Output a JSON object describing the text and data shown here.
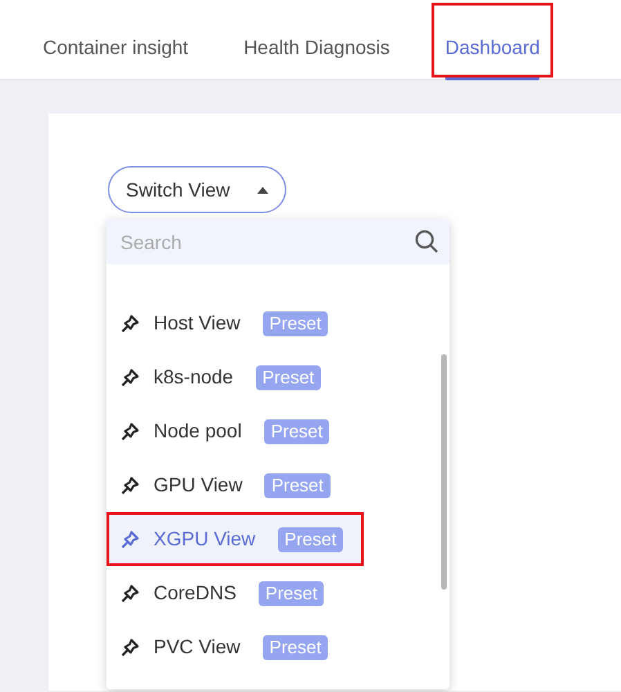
{
  "tabs": [
    {
      "label": "Container insight",
      "selected": false,
      "highlighted": false
    },
    {
      "label": "Health Diagnosis",
      "selected": false,
      "highlighted": false
    },
    {
      "label": "Dashboard",
      "selected": true,
      "highlighted": true
    }
  ],
  "switch_view": {
    "label": "Switch View",
    "expanded": true
  },
  "dropdown": {
    "search": {
      "placeholder": "Search"
    },
    "items": [
      {
        "name": "Host View",
        "badge": "Preset",
        "selected": false,
        "highlighted": false
      },
      {
        "name": "k8s-node",
        "badge": "Preset",
        "selected": false,
        "highlighted": false
      },
      {
        "name": "Node pool",
        "badge": "Preset",
        "selected": false,
        "highlighted": false
      },
      {
        "name": "GPU View",
        "badge": "Preset",
        "selected": false,
        "highlighted": false
      },
      {
        "name": "XGPU View",
        "badge": "Preset",
        "selected": true,
        "highlighted": true
      },
      {
        "name": "CoreDNS",
        "badge": "Preset",
        "selected": false,
        "highlighted": false
      },
      {
        "name": "PVC View",
        "badge": "Preset",
        "selected": false,
        "highlighted": false
      }
    ]
  }
}
